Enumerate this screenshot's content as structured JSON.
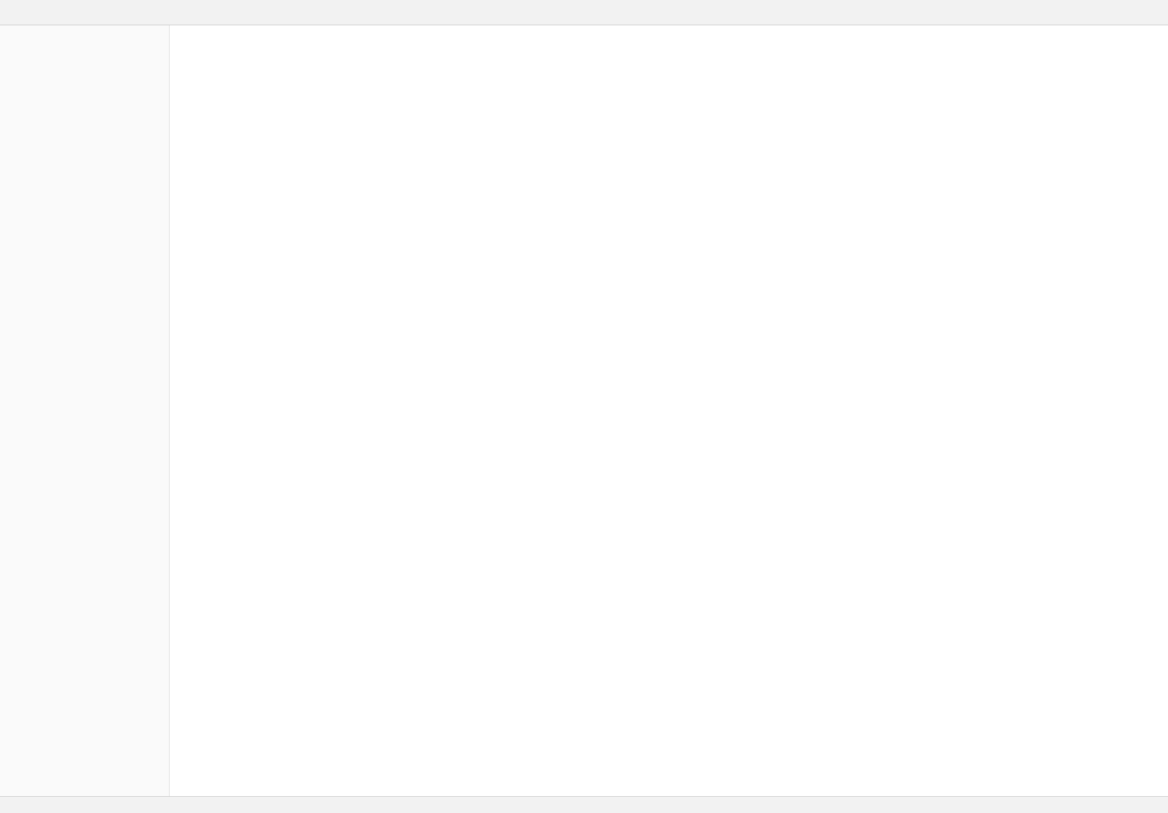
{
  "window": {
    "title": ""
  },
  "sidebar": {
    "items": []
  },
  "main": {
    "heading": "",
    "note": ""
  },
  "status": {
    "text": ""
  }
}
